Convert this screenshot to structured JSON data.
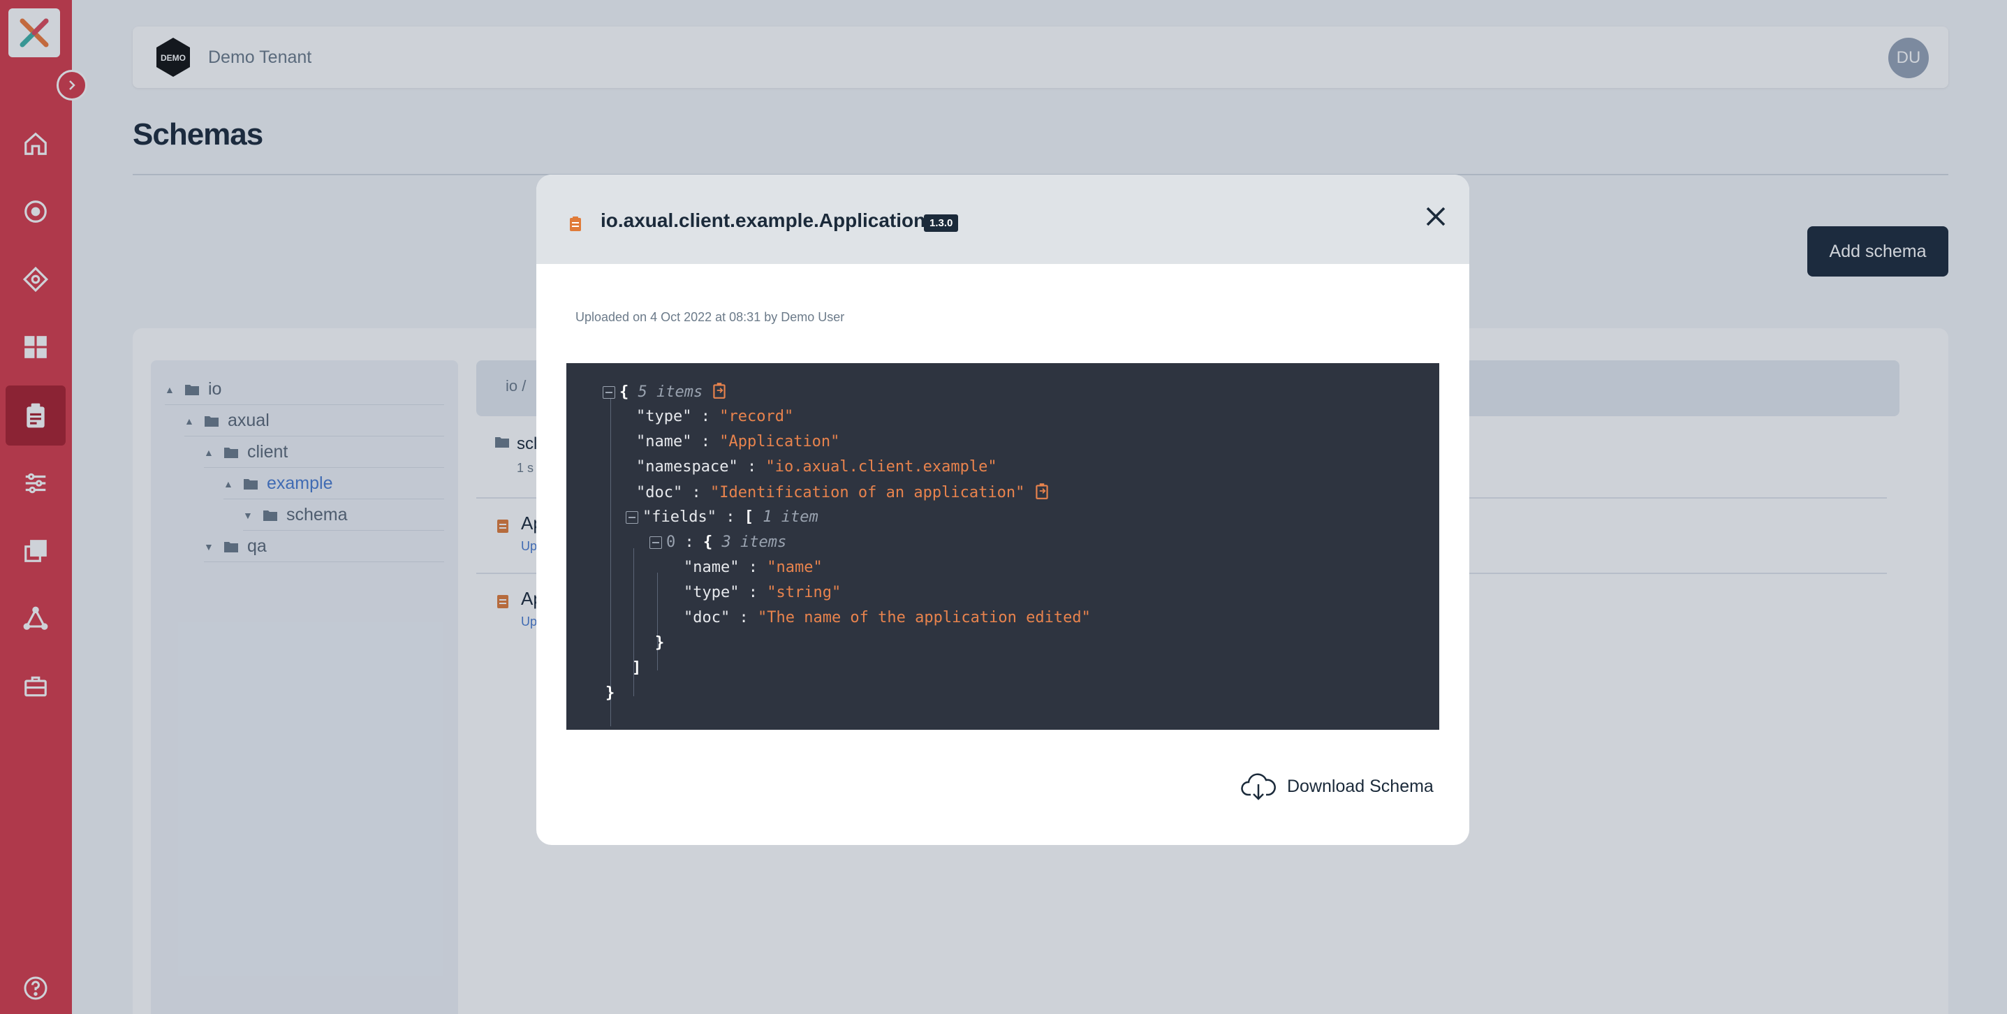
{
  "header": {
    "tenant_name": "Demo Tenant",
    "tenant_logo_text": "DEMO",
    "avatar_initials": "DU"
  },
  "page": {
    "title": "Schemas",
    "add_button": "Add schema"
  },
  "tree": {
    "items": [
      {
        "label": "io"
      },
      {
        "label": "axual"
      },
      {
        "label": "client"
      },
      {
        "label": "example"
      },
      {
        "label": "schema"
      },
      {
        "label": "qa"
      }
    ]
  },
  "breadcrumb": "io /",
  "list": {
    "folder_title": "scl",
    "folder_sub": "1 s",
    "items": [
      {
        "title": "Ap",
        "sub": "Up"
      },
      {
        "title": "Ap",
        "sub": "Up"
      }
    ]
  },
  "modal": {
    "title": "io.axual.client.example.Application",
    "version": "1.3.0",
    "uploaded": "Uploaded on 4 Oct 2022 at 08:31 by Demo User",
    "download_label": "Download Schema",
    "json": {
      "root_meta": "5 items",
      "type_key": "\"type\"",
      "type_val": "\"record\"",
      "name_key": "\"name\"",
      "name_val": "\"Application\"",
      "ns_key": "\"namespace\"",
      "ns_val": "\"io.axual.client.example\"",
      "doc_key": "\"doc\"",
      "doc_val": "\"Identification of an application\"",
      "fields_key": "\"fields\"",
      "fields_meta": "1 item",
      "idx": "0",
      "obj_meta": "3 items",
      "f_name_key": "\"name\"",
      "f_name_val": "\"name\"",
      "f_type_key": "\"type\"",
      "f_type_val": "\"string\"",
      "f_doc_key": "\"doc\"",
      "f_doc_val": "\"The name of the application edited\""
    }
  },
  "colors": {
    "sidebar": "#d83c4b",
    "sidebar_active": "#aa1f2e",
    "primary": "#1b2a3a",
    "code_bg": "#2e3440",
    "string": "#e8834d"
  }
}
